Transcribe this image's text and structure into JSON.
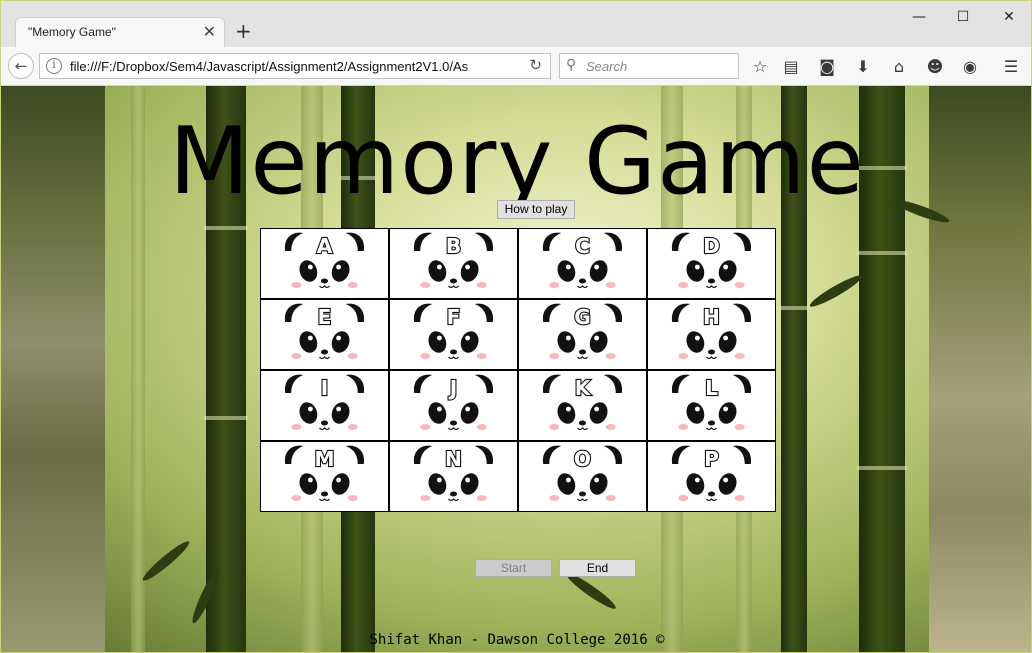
{
  "browser": {
    "tab_title": "\"Memory Game\"",
    "tab_close": "✕",
    "new_tab": "+",
    "url": "file:///F:/Dropbox/Sem4/Javascript/Assignment2/Assignment2V1.0/As",
    "search_placeholder": "Search",
    "window_controls": {
      "minimize": "—",
      "maximize": "☐",
      "close": "✕"
    }
  },
  "page": {
    "title": "Memory Game",
    "how_to_play_label": "How to play",
    "cards": [
      {
        "letter": "A"
      },
      {
        "letter": "B"
      },
      {
        "letter": "C"
      },
      {
        "letter": "D"
      },
      {
        "letter": "E"
      },
      {
        "letter": "F"
      },
      {
        "letter": "G"
      },
      {
        "letter": "H"
      },
      {
        "letter": "I"
      },
      {
        "letter": "J"
      },
      {
        "letter": "K"
      },
      {
        "letter": "L"
      },
      {
        "letter": "M"
      },
      {
        "letter": "N"
      },
      {
        "letter": "O"
      },
      {
        "letter": "P"
      }
    ],
    "start_label": "Start",
    "end_label": "End",
    "footer": "Shifat Khan - Dawson College 2016 ©"
  },
  "colors": {
    "card_border": "#000000",
    "panda_black": "#111111",
    "blush": "#f6b7bd",
    "start_disabled_bg": "#cccccc",
    "button_bg": "#e1e1e1"
  }
}
